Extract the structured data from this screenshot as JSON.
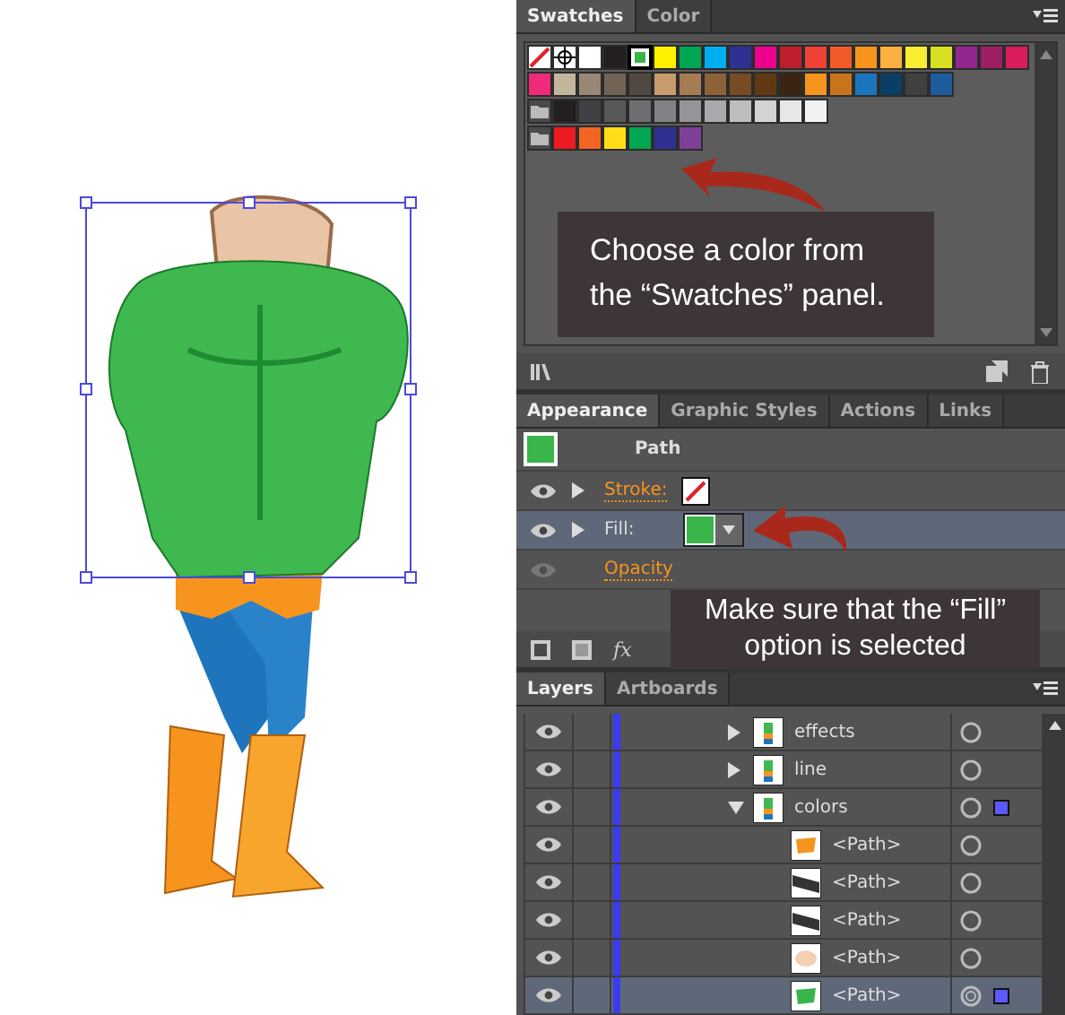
{
  "swatches_panel": {
    "tabs": [
      {
        "label": "Swatches",
        "selected": true
      },
      {
        "label": "Color",
        "selected": false
      }
    ],
    "rows": [
      [
        {
          "kind": "none",
          "selected": false
        },
        {
          "kind": "registration",
          "selected": false
        },
        {
          "kind": "color",
          "color": "#ffffff",
          "selected": false
        },
        {
          "kind": "color",
          "color": "#231f20",
          "selected": false
        },
        {
          "kind": "color",
          "color": "#39b54a",
          "selected": true
        },
        {
          "kind": "color",
          "color": "#fff200",
          "selected": false
        },
        {
          "kind": "color",
          "color": "#00a651",
          "selected": false
        },
        {
          "kind": "color",
          "color": "#00aeef",
          "selected": false
        },
        {
          "kind": "color",
          "color": "#2e3192",
          "selected": false
        },
        {
          "kind": "color",
          "color": "#ec008c",
          "selected": false
        },
        {
          "kind": "color",
          "color": "#be1e2d",
          "selected": false
        },
        {
          "kind": "color",
          "color": "#ef4136",
          "selected": false
        },
        {
          "kind": "color",
          "color": "#f15a29",
          "selected": false
        },
        {
          "kind": "color",
          "color": "#f7941d",
          "selected": false
        },
        {
          "kind": "color",
          "color": "#fbb040",
          "selected": false
        },
        {
          "kind": "color",
          "color": "#f9ed32",
          "selected": false
        },
        {
          "kind": "color",
          "color": "#d7df23",
          "selected": false
        },
        {
          "kind": "color",
          "color": "#92278f",
          "selected": false
        },
        {
          "kind": "color",
          "color": "#9e1f63",
          "selected": false
        },
        {
          "kind": "color",
          "color": "#da1c5c",
          "selected": false
        }
      ],
      [
        {
          "kind": "color",
          "color": "#ee2a7b",
          "selected": false
        },
        {
          "kind": "color",
          "color": "#c2b59b",
          "selected": false
        },
        {
          "kind": "color",
          "color": "#998675",
          "selected": false
        },
        {
          "kind": "color",
          "color": "#736357",
          "selected": false
        },
        {
          "kind": "color",
          "color": "#534741",
          "selected": false
        },
        {
          "kind": "color",
          "color": "#c69c6d",
          "selected": false
        },
        {
          "kind": "color",
          "color": "#a67c52",
          "selected": false
        },
        {
          "kind": "color",
          "color": "#8c6239",
          "selected": false
        },
        {
          "kind": "color",
          "color": "#754c24",
          "selected": false
        },
        {
          "kind": "color",
          "color": "#603913",
          "selected": false
        },
        {
          "kind": "color",
          "color": "#3c2415",
          "selected": false
        },
        {
          "kind": "color",
          "color": "#f7941d",
          "selected": false
        },
        {
          "kind": "color",
          "color": "#c8741c",
          "selected": false
        },
        {
          "kind": "color",
          "color": "#1b75bc",
          "selected": false
        },
        {
          "kind": "color",
          "color": "#0b3e64",
          "selected": false
        },
        {
          "kind": "color",
          "color": "#404040",
          "selected": false
        },
        {
          "kind": "color",
          "color": "#1c5c9c",
          "selected": false
        }
      ],
      [
        {
          "kind": "folder",
          "selected": false
        },
        {
          "kind": "color",
          "color": "#231f20",
          "selected": false
        },
        {
          "kind": "color",
          "color": "#414042",
          "selected": false
        },
        {
          "kind": "color",
          "color": "#58595b",
          "selected": false
        },
        {
          "kind": "color",
          "color": "#6d6e71",
          "selected": false
        },
        {
          "kind": "color",
          "color": "#808285",
          "selected": false
        },
        {
          "kind": "color",
          "color": "#939598",
          "selected": false
        },
        {
          "kind": "color",
          "color": "#a7a9ac",
          "selected": false
        },
        {
          "kind": "color",
          "color": "#bcbec0",
          "selected": false
        },
        {
          "kind": "color",
          "color": "#d1d3d4",
          "selected": false
        },
        {
          "kind": "color",
          "color": "#e6e7e8",
          "selected": false
        },
        {
          "kind": "color",
          "color": "#f1f2f2",
          "selected": false
        }
      ],
      [
        {
          "kind": "folder",
          "selected": false
        },
        {
          "kind": "color",
          "color": "#ed1c24",
          "selected": false
        },
        {
          "kind": "color",
          "color": "#f26522",
          "selected": false
        },
        {
          "kind": "color",
          "color": "#ffde17",
          "selected": false
        },
        {
          "kind": "color",
          "color": "#00a651",
          "selected": false
        },
        {
          "kind": "color",
          "color": "#2e3192",
          "selected": false
        },
        {
          "kind": "color",
          "color": "#7f3f98",
          "selected": false
        }
      ]
    ]
  },
  "appearance_panel": {
    "tabs": [
      {
        "label": "Appearance",
        "selected": true
      },
      {
        "label": "Graphic Styles",
        "selected": false
      },
      {
        "label": "Actions",
        "selected": false
      },
      {
        "label": "Links",
        "selected": false
      }
    ],
    "object": {
      "label": "Path",
      "color": "#39b54a"
    },
    "rows": [
      {
        "kind": "stroke",
        "label": "Stroke:",
        "selected": false,
        "disabled": false,
        "swatch": {
          "kind": "none"
        }
      },
      {
        "kind": "fill",
        "label": "Fill:",
        "selected": true,
        "disabled": false,
        "swatch": {
          "kind": "color",
          "color": "#39b54a"
        }
      },
      {
        "kind": "opacity",
        "label": "Opacity",
        "selected": false,
        "disabled": true
      }
    ],
    "effects_button": "fx"
  },
  "layers_panel": {
    "tabs": [
      {
        "label": "Layers",
        "selected": true
      },
      {
        "label": "Artboards",
        "selected": false
      }
    ],
    "layers": [
      {
        "name": "effects",
        "expanded": false,
        "selected": false,
        "has_selection": false
      },
      {
        "name": "line",
        "expanded": false,
        "selected": false,
        "has_selection": false
      },
      {
        "name": "colors",
        "expanded": true,
        "selected": false,
        "has_selection": true,
        "children": [
          {
            "name": "<Path>",
            "kind": "blob",
            "color": "#f7941d",
            "selected": false
          },
          {
            "name": "<Path>",
            "kind": "band",
            "color": "#333333",
            "selected": false
          },
          {
            "name": "<Path>",
            "kind": "band",
            "color": "#333333",
            "selected": false
          },
          {
            "name": "<Path>",
            "kind": "ellipse",
            "color": "#f3cfb4",
            "selected": false
          },
          {
            "name": "<Path>",
            "kind": "blob",
            "color": "#39b54a",
            "selected": true
          }
        ]
      }
    ]
  },
  "callouts": [
    {
      "text": "Choose a color from the “Swatches” panel."
    },
    {
      "text": "Make sure that the “Fill” option is selected"
    }
  ]
}
